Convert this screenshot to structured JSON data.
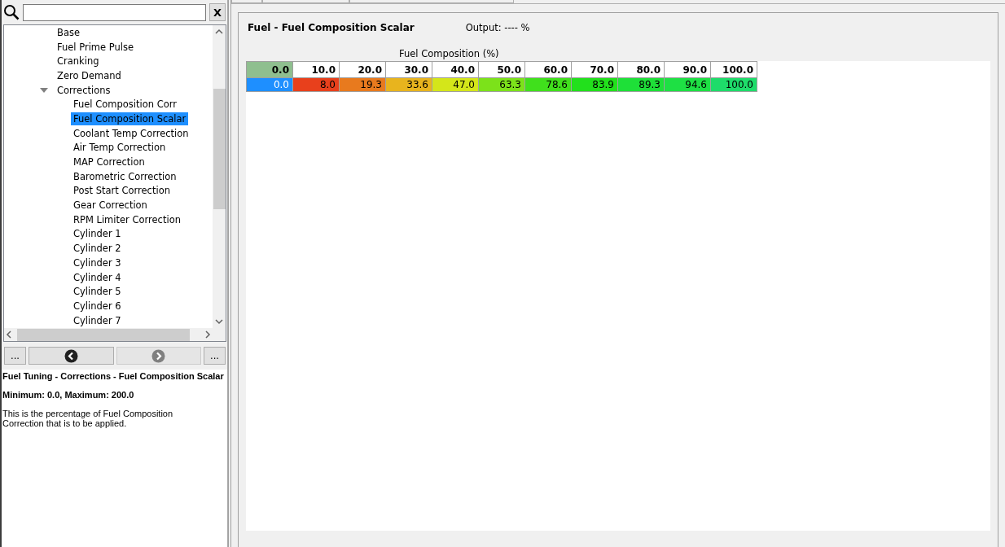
{
  "search": {
    "clear_label": "X"
  },
  "tree": {
    "items": [
      {
        "label": "Base",
        "selected": false
      },
      {
        "label": "Fuel Prime Pulse",
        "selected": false
      },
      {
        "label": "Cranking",
        "selected": false
      },
      {
        "label": "Zero Demand",
        "selected": false
      },
      {
        "label": "Corrections",
        "selected": false,
        "expanded": true,
        "children": [
          {
            "label": "Fuel Composition Corr",
            "selected": false
          },
          {
            "label": "Fuel Composition Scalar",
            "selected": true
          },
          {
            "label": "Coolant Temp Correction",
            "selected": false
          },
          {
            "label": "Air Temp Correction",
            "selected": false
          },
          {
            "label": "MAP Correction",
            "selected": false
          },
          {
            "label": "Barometric Correction",
            "selected": false
          },
          {
            "label": "Post Start Correction",
            "selected": false
          },
          {
            "label": "Gear Correction",
            "selected": false
          },
          {
            "label": "RPM Limiter Correction",
            "selected": false
          },
          {
            "label": "Cylinder 1",
            "selected": false
          },
          {
            "label": "Cylinder 2",
            "selected": false
          },
          {
            "label": "Cylinder 3",
            "selected": false
          },
          {
            "label": "Cylinder 4",
            "selected": false
          },
          {
            "label": "Cylinder 5",
            "selected": false
          },
          {
            "label": "Cylinder 6",
            "selected": false
          },
          {
            "label": "Cylinder 7",
            "selected": false
          }
        ]
      }
    ]
  },
  "nav": {
    "first_label": "...",
    "last_label": "...",
    "back_disabled": false,
    "forward_disabled": true
  },
  "help": {
    "path": "Fuel Tuning - Corrections - Fuel Composition Scalar",
    "range": "Minimum: 0.0, Maximum: 200.0",
    "description": "This is the percentage of Fuel Composition Correction that is to be applied."
  },
  "editor": {
    "title": "Fuel - Fuel Composition Scalar",
    "output": "Output: ---- %",
    "axis_label": "Fuel Composition (%)",
    "columns": [
      {
        "label": "0.0",
        "selected": true
      },
      {
        "label": "10.0",
        "selected": false
      },
      {
        "label": "20.0",
        "selected": false
      },
      {
        "label": "30.0",
        "selected": false
      },
      {
        "label": "40.0",
        "selected": false
      },
      {
        "label": "50.0",
        "selected": false
      },
      {
        "label": "60.0",
        "selected": false
      },
      {
        "label": "70.0",
        "selected": false
      },
      {
        "label": "80.0",
        "selected": false
      },
      {
        "label": "90.0",
        "selected": false
      },
      {
        "label": "100.0",
        "selected": false
      }
    ],
    "values": [
      {
        "text": "0.0",
        "color": "#1e8fff",
        "selected": true
      },
      {
        "text": "8.0",
        "color": "#e8401c",
        "selected": false
      },
      {
        "text": "19.3",
        "color": "#e87a1e",
        "selected": false
      },
      {
        "text": "33.6",
        "color": "#e8b41e",
        "selected": false
      },
      {
        "text": "47.0",
        "color": "#d4e61a",
        "selected": false
      },
      {
        "text": "63.3",
        "color": "#7ce21a",
        "selected": false
      },
      {
        "text": "78.6",
        "color": "#40e01c",
        "selected": false
      },
      {
        "text": "83.9",
        "color": "#22e01c",
        "selected": false
      },
      {
        "text": "89.3",
        "color": "#1ee038",
        "selected": false
      },
      {
        "text": "94.6",
        "color": "#1ee044",
        "selected": false
      },
      {
        "text": "100.0",
        "color": "#1edc6a",
        "selected": false
      }
    ]
  }
}
